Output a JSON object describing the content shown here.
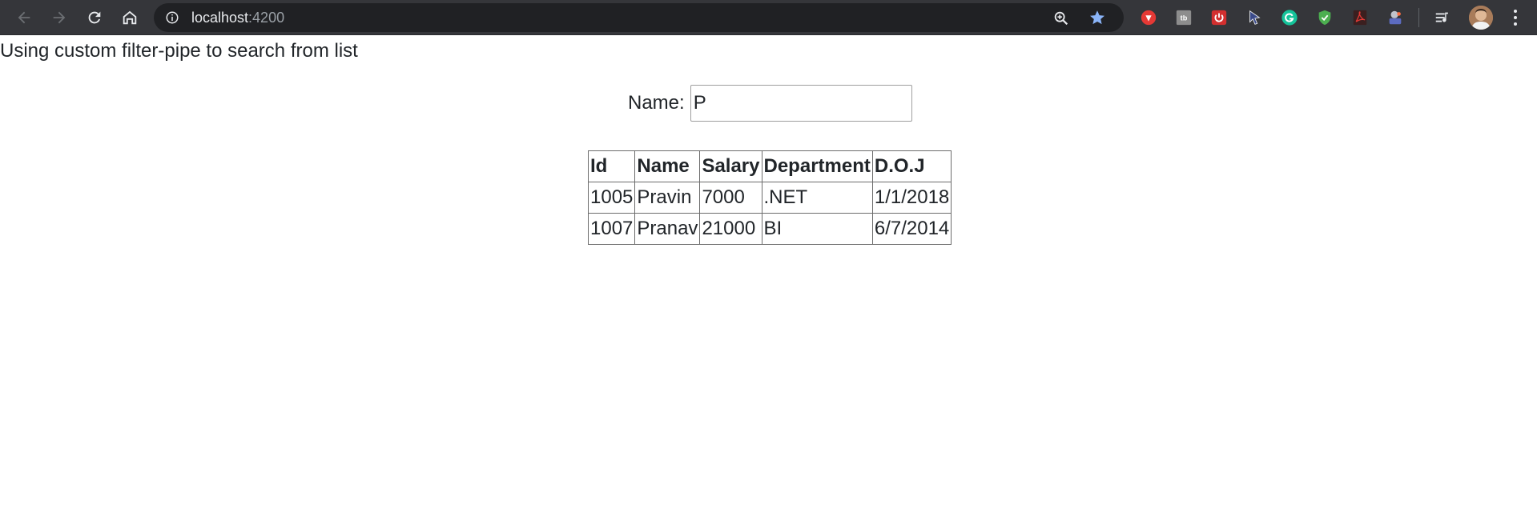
{
  "browser": {
    "url_host": "localhost",
    "url_port": ":4200",
    "icons": {
      "back": "arrow-left-icon",
      "forward": "arrow-right-icon",
      "reload": "reload-icon",
      "home": "home-icon",
      "site_info": "info-icon",
      "zoom": "zoom-icon",
      "bookmark": "star-icon",
      "menu": "kebab-menu-icon"
    },
    "extensions": [
      "red-extension-icon",
      "tb-extension-icon",
      "power-extension-icon",
      "cursor-extension-icon",
      "grammarly-icon",
      "shield-extension-icon",
      "pdf-extension-icon",
      "paint-extension-icon",
      "reading-list-icon"
    ],
    "colors": {
      "toolbar": "#35363a",
      "omnibox": "#202124",
      "bookmark_star": "#8ab4f8"
    }
  },
  "page": {
    "heading": "Using custom filter-pipe to search from list",
    "filter": {
      "label": "Name:",
      "value": "P"
    },
    "table": {
      "columns": [
        "Id",
        "Name",
        "Salary",
        "Department",
        "D.O.J"
      ],
      "rows": [
        [
          "1005",
          "Pravin",
          "7000",
          ".NET",
          "1/1/2018"
        ],
        [
          "1007",
          "Pranav",
          "21000",
          "BI",
          "6/7/2014"
        ]
      ]
    }
  }
}
